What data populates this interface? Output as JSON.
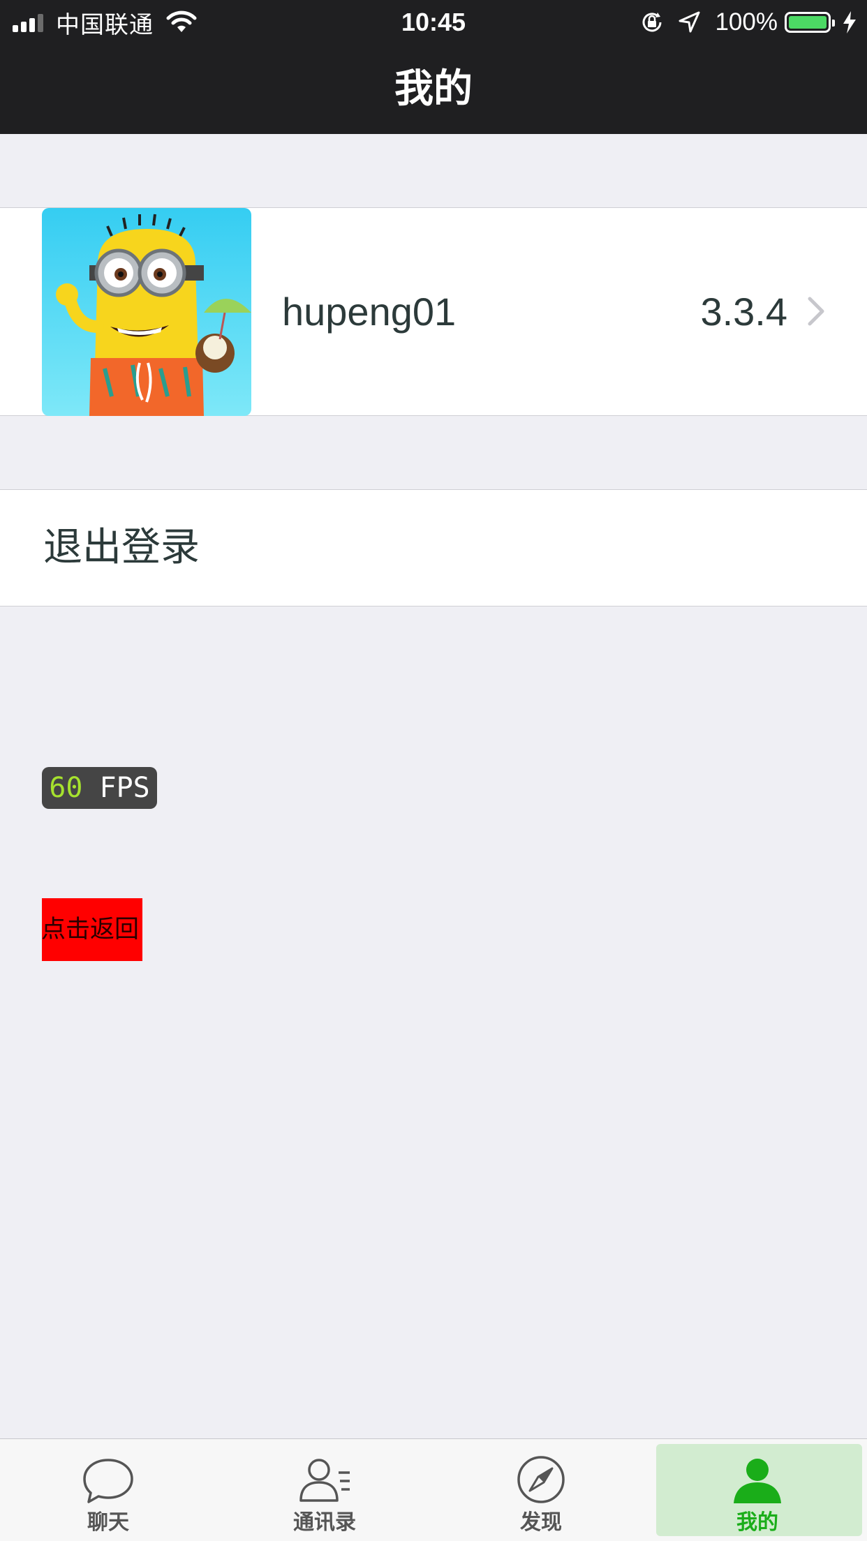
{
  "status_bar": {
    "carrier": "中国联通",
    "time": "10:45",
    "battery_percent": "100%",
    "battery_level": 1.0,
    "signal_bars_on": 3,
    "signal_bars_total": 4,
    "icons": [
      "signal-icon",
      "wifi-icon",
      "orientation-lock-icon",
      "location-icon",
      "battery-icon",
      "charging-icon"
    ]
  },
  "nav": {
    "title": "我的"
  },
  "profile": {
    "avatar_icon": "minion-avatar",
    "username": "hupeng01",
    "version": "3.3.4",
    "chevron_icon": "chevron-right-icon"
  },
  "logout": {
    "label": "退出登录"
  },
  "debug": {
    "fps_value": "60",
    "fps_unit": "FPS",
    "back_button": "点击返回"
  },
  "tabbar": {
    "tabs": [
      {
        "label": "聊天",
        "icon": "chat-bubble-icon",
        "active": false
      },
      {
        "label": "通讯录",
        "icon": "contacts-icon",
        "active": false
      },
      {
        "label": "发现",
        "icon": "compass-icon",
        "active": false
      },
      {
        "label": "我的",
        "icon": "person-icon",
        "active": true
      }
    ]
  },
  "colors": {
    "bar_background": "#1f1f21",
    "page_background": "#efeff4",
    "active_tint": "#1aad19",
    "active_tab_highlight": "#d2ecd0",
    "back_button_bg": "#ff0000",
    "fps_badge_bg": "#454545",
    "fps_number": "#a6e22e"
  }
}
